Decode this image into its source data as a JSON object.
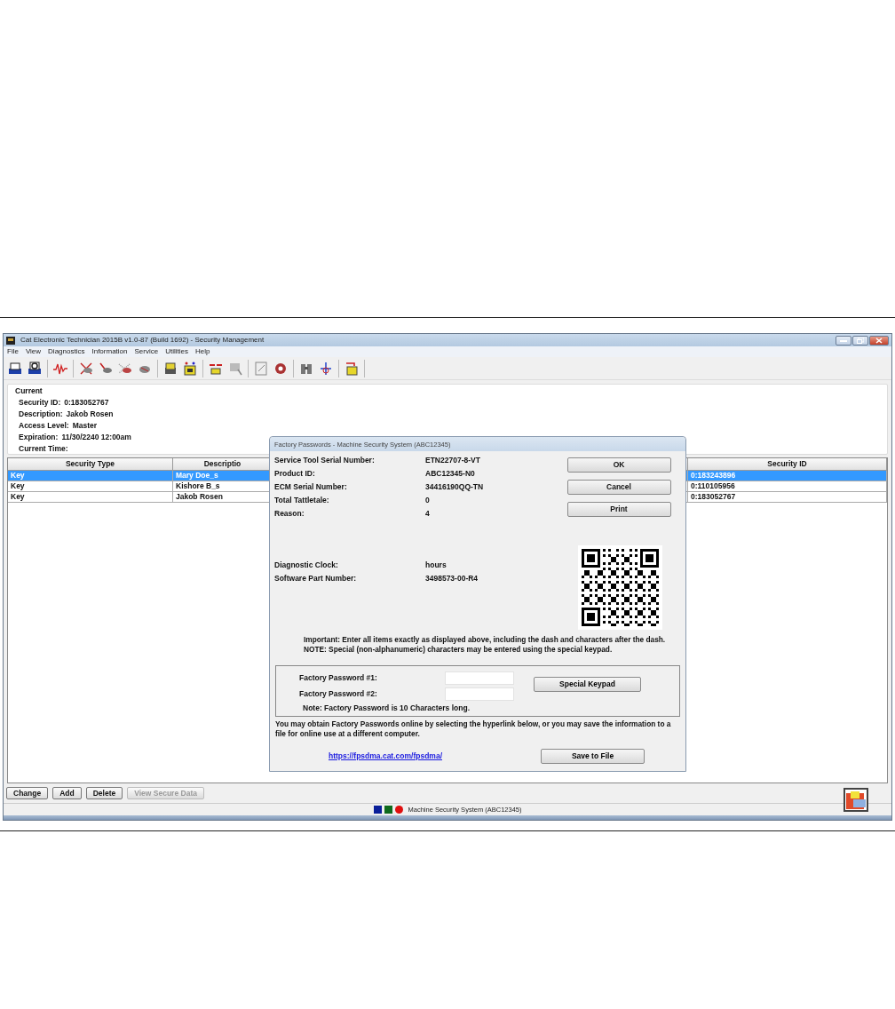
{
  "window": {
    "title": "Cat Electronic Technician 2015B v1.0-87 (Build 1692) - Security Management"
  },
  "menu": [
    "File",
    "View",
    "Diagnostics",
    "Information",
    "Service",
    "Utilities",
    "Help"
  ],
  "current": {
    "heading": "Current",
    "fields": [
      {
        "label": "Security ID:",
        "value": "0:183052767"
      },
      {
        "label": "Description:",
        "value": "Jakob Rosen"
      },
      {
        "label": "Access Level:",
        "value": "Master"
      },
      {
        "label": "Expiration:",
        "value": "11/30/2240 12:00am"
      },
      {
        "label": "Current Time:"
      }
    ]
  },
  "table": {
    "columns": [
      "Security Type",
      "Descriptio",
      "Security ID"
    ],
    "rows": [
      {
        "cells": [
          "Key",
          "Mary Doe_s",
          "0:183243896"
        ],
        "selected": true
      },
      {
        "cells": [
          "Key",
          "Kishore B_s",
          "0:110105956"
        ],
        "selected": false
      },
      {
        "cells": [
          "Key",
          "Jakob Rosen",
          "0:183052767"
        ],
        "selected": false
      }
    ]
  },
  "buttons": [
    {
      "label": "Change",
      "disabled": false
    },
    {
      "label": "Add",
      "disabled": false
    },
    {
      "label": "Delete",
      "disabled": false
    },
    {
      "label": "View Secure Data",
      "disabled": true
    }
  ],
  "status_bar": {
    "indicators": [
      {
        "kind": "square",
        "color": "#0a1f9a"
      },
      {
        "kind": "square",
        "color": "#0e6a1c"
      },
      {
        "kind": "dot",
        "color": "#e00f0f"
      }
    ],
    "text": "Machine Security System (ABC12345)"
  },
  "dialog": {
    "title": "Factory Passwords - Machine Security System (ABC12345)",
    "fields": [
      {
        "label": "Service Tool Serial Number:",
        "value": "ETN22707-8-VT"
      },
      {
        "label": "Product ID:",
        "value": "ABC12345-N0"
      },
      {
        "label": "ECM Serial Number:",
        "value": "34416190QQ-TN"
      },
      {
        "label": "Total Tattletale:",
        "value": "0"
      },
      {
        "label": "Reason:",
        "value": "4"
      }
    ],
    "clock_fields": [
      {
        "label": "Diagnostic Clock:",
        "value": "hours"
      },
      {
        "label": "Software Part Number:",
        "value": "3498573-00-R4"
      }
    ],
    "buttons": [
      "OK",
      "Cancel",
      "Print"
    ],
    "important": "Important: Enter all items exactly as displayed above, including the dash and characters after the dash.  NOTE: Special (non-alphanumeric) characters may be entered using the special keypad.",
    "passwords": [
      {
        "label": "Factory Password #1:"
      },
      {
        "label": "Factory Password #2:"
      }
    ],
    "keypad_button": "Special Keypad",
    "password_note": "Note: Factory Password is 10 Characters long.",
    "info": "You may obtain Factory Passwords online by selecting the hyperlink below, or you may save the information to a file for online use at a different computer.",
    "link": "https://fpsdma.cat.com/fpsdma/",
    "save_button": "Save to File"
  }
}
